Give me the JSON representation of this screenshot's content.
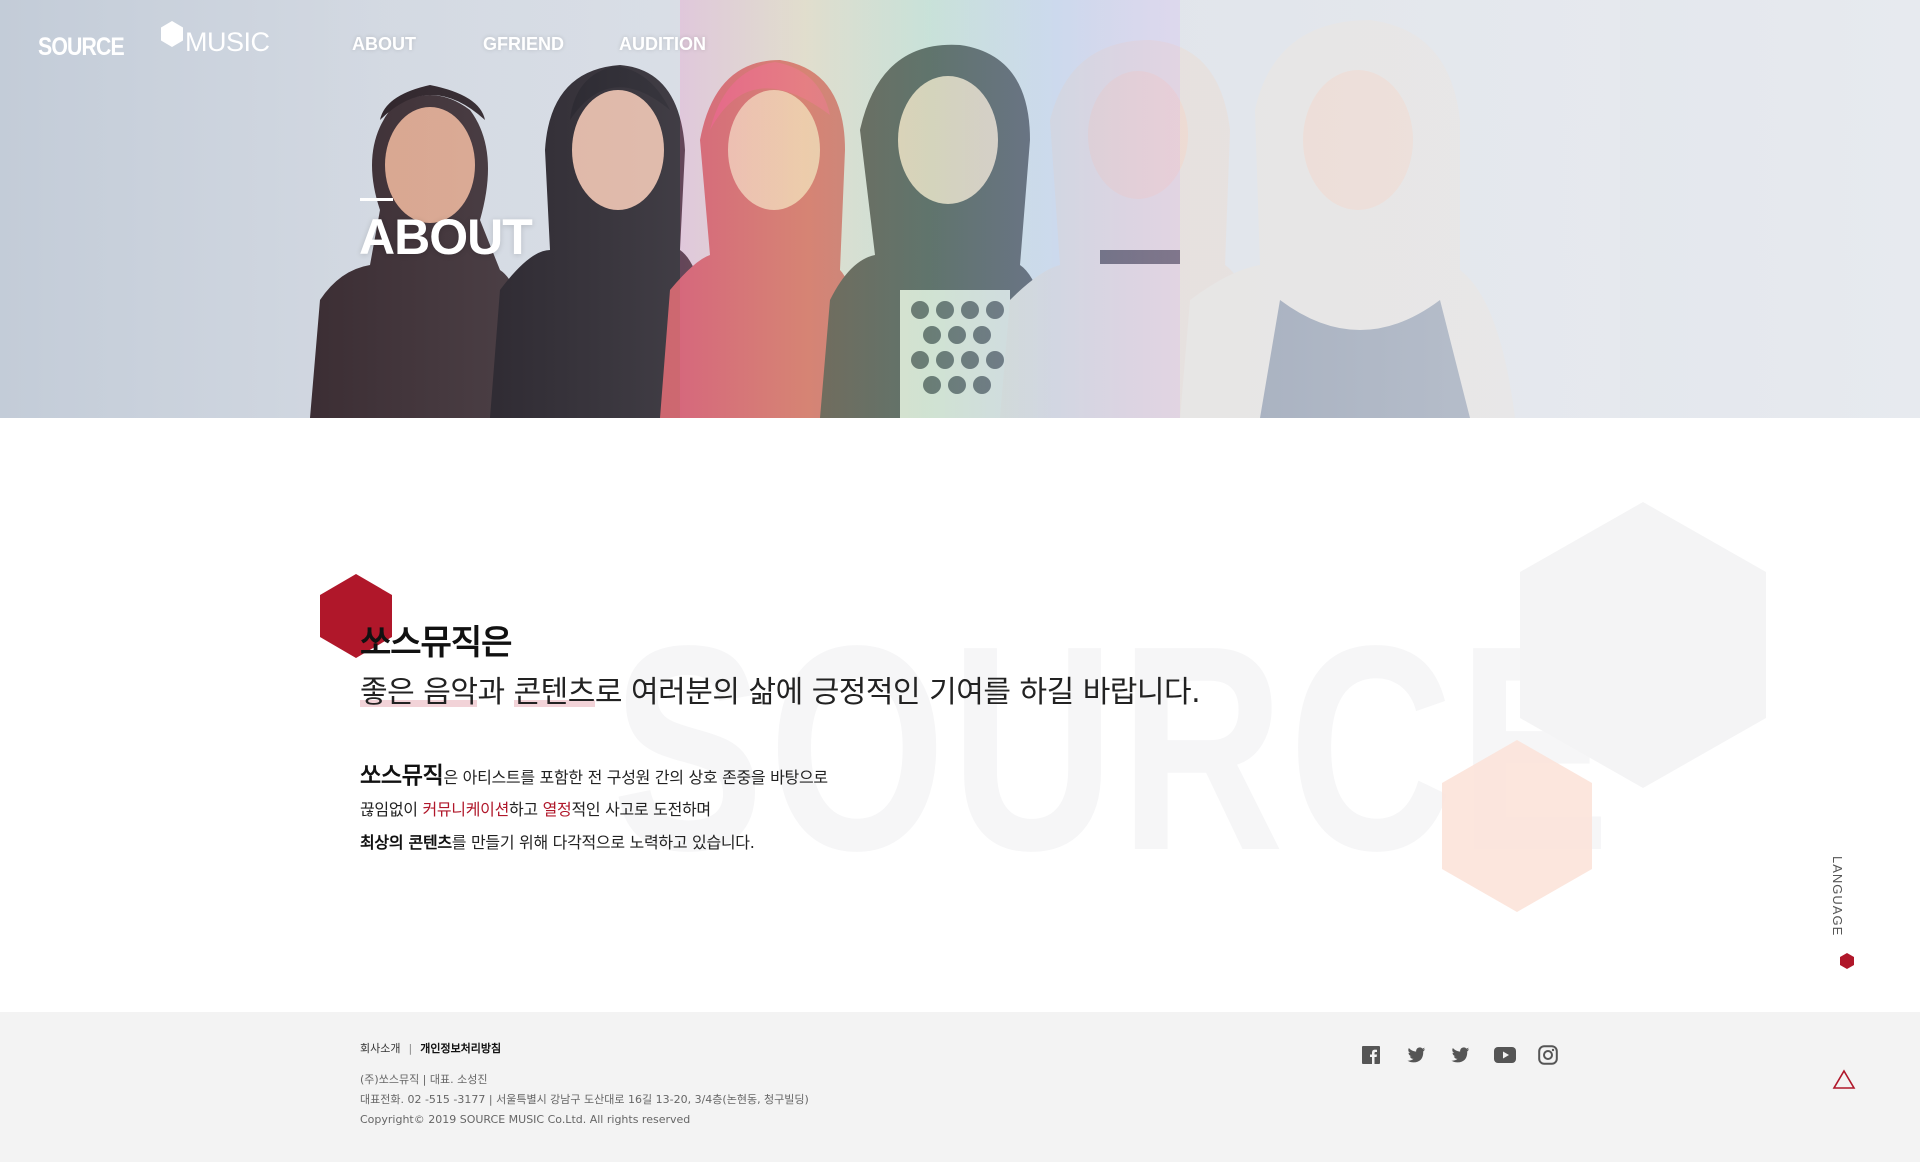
{
  "brand": {
    "logo_word": "SOURCE",
    "logo_word_2": "MUSIC"
  },
  "nav": {
    "items": [
      {
        "label": "ABOUT"
      },
      {
        "label": "GFRIEND"
      },
      {
        "label": "AUDITION"
      }
    ]
  },
  "hero": {
    "title": "ABOUT"
  },
  "intro": {
    "heading": "쏘스뮤직은",
    "sub_parts": [
      "좋은 음악",
      "과 ",
      "콘텐츠",
      "로 여러분의 삶에 긍정적인 기여를 하길 바랍니다."
    ],
    "background_word": "SOURCE"
  },
  "body": {
    "line1_strong": "쏘스뮤직",
    "line1_rest": "은 아티스트를 포함한 전 구성원 간의 상호 존중을 바탕으로",
    "line2_a": "끊임없이 ",
    "line2_accent1": "커뮤니케이션",
    "line2_b": "하고 ",
    "line2_accent2": "열정",
    "line2_c": "적인 사고로 도전하며",
    "line3_bold": "최상의 콘텐츠",
    "line3_rest": "를 만들기 위해 다각적으로 노력하고 있습니다."
  },
  "language": {
    "label": "LANGUAGE"
  },
  "footer": {
    "links": [
      {
        "label": "회사소개"
      },
      {
        "label": "개인정보처리방침"
      }
    ],
    "separator": "|",
    "info_line1": "(주)쏘스뮤직  |  대표. 소성진",
    "info_line2": "대표전화. 02 -515 -3177  |  서울특별시 강남구 도산대로 16길 13-20, 3/4층(논현동, 청구빌딩)",
    "copyright": "Copyright© 2019 SOURCE MUSIC Co.Ltd. All rights reserved"
  },
  "social": [
    {
      "icon": "facebook-icon"
    },
    {
      "icon": "twitter-icon"
    },
    {
      "icon": "twitter-icon"
    },
    {
      "icon": "youtube-icon"
    },
    {
      "icon": "instagram-icon"
    }
  ],
  "colors": {
    "accent": "#b0172a",
    "highlight": "#f2d3d8",
    "peach": "#fce3d9",
    "footer_bg": "#f3f3f3"
  }
}
